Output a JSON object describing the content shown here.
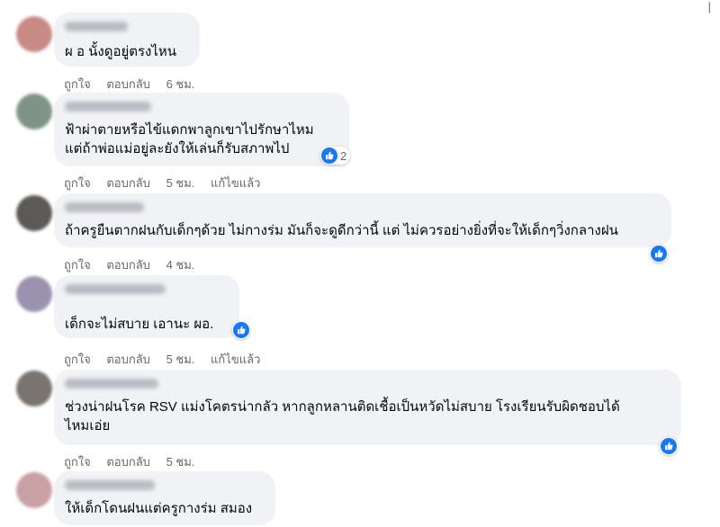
{
  "comments": [
    {
      "avatar_color": "#c98a86",
      "text": "ผ อ นั้งดูอยู่ตรงไหน",
      "like": "ถูกใจ",
      "reply": "ตอบกลับ",
      "time": "6 ชม.",
      "edited": "",
      "reaction_count": ""
    },
    {
      "avatar_color": "#7f9486",
      "text": "ฟ้าผ่าตายหรือไข้แดกพาลูกเขาไปรักษาไหม\nแต่ถ้าพ่อแม่อยู่ละยังให้เล่นก็รับสภาพไป",
      "like": "ถูกใจ",
      "reply": "ตอบกลับ",
      "time": "5 ชม.",
      "edited": "แก้ไขแล้ว",
      "reaction_count": "2"
    },
    {
      "avatar_color": "#5c5a56",
      "text": "ถ้าครูยืนตากฝนกับเด็กๆด้วย ไม่กางร่ม มันก็จะดูดีกว่านี้ แต่ ไม่ควรอย่างยิ่งที่จะให้เด็กๆวิ่งกลางฝน",
      "like": "ถูกใจ",
      "reply": "ตอบกลับ",
      "time": "4 ชม.",
      "edited": "",
      "reaction_count": ""
    },
    {
      "avatar_color": "#9b92b0",
      "text": "เด็กจะไม่สบาย เอานะ ผอ.",
      "like": "ถูกใจ",
      "reply": "ตอบกลับ",
      "time": "5 ชม.",
      "edited": "แก้ไขแล้ว",
      "reaction_count": ""
    },
    {
      "avatar_color": "#7a7470",
      "text": "ช่วงน่าฝนโรค RSV แม่งโคตรน่ากลัว หากลูกหลานติดเชื้อเป็นหวัดไม่สบาย โรงเรียนรับผิดชอบได้\nไหมเอ่ย",
      "like": "ถูกใจ",
      "reply": "ตอบกลับ",
      "time": "5 ชม.",
      "edited": "",
      "reaction_count": ""
    },
    {
      "avatar_color": "#c9a0a4",
      "text": "ให้เด็กโดนฝนแต่ครูกางร่ม สมอง",
      "like": "",
      "reply": "",
      "time": "",
      "edited": "",
      "reaction_count": ""
    }
  ],
  "colors": {
    "like_blue": "#1877f2",
    "bubble": "#f0f2f5",
    "meta": "#65676b"
  }
}
